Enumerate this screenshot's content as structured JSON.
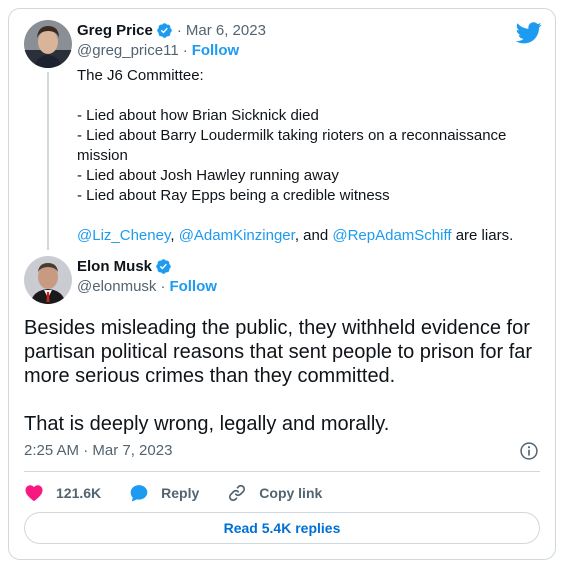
{
  "quoted_tweet": {
    "author_name": "Greg Price",
    "handle": "@greg_price11",
    "separator": "·",
    "date": "Mar 6, 2023",
    "follow_label": "Follow",
    "lines": [
      "The J6 Committee:",
      "",
      "- Lied about how Brian Sicknick died",
      "- Lied about Barry Loudermilk taking rioters on a reconnaissance mission",
      "- Lied about Josh Hawley running away",
      "- Lied about Ray Epps being a credible witness",
      ""
    ],
    "mention_1": "@Liz_Cheney",
    "comma": ",",
    "mention_2": "@AdamKinzinger",
    "and_text": ", and",
    "mention_3": "@RepAdamSchiff",
    "suffix": " are liars."
  },
  "main_tweet": {
    "author_name": "Elon Musk",
    "handle": "@elonmusk",
    "separator": "·",
    "follow_label": "Follow",
    "paragraph_1": "Besides misleading the public, they withheld evidence for partisan political reasons that sent people to prison for far more serious crimes than they committed.",
    "paragraph_2": "That is deeply wrong, legally and morally.",
    "timestamp": "2:25 AM · Mar 7, 2023"
  },
  "actions": {
    "like_count": "121.6K",
    "reply_label": "Reply",
    "copy_label": "Copy link"
  },
  "read_replies_label": "Read 5.4K replies",
  "icons": {
    "brand": "twitter-bird-icon",
    "verified": "verified-badge-icon",
    "info": "info-icon",
    "like": "heart-icon",
    "reply": "speech-bubble-icon",
    "copy": "link-icon"
  },
  "colors": {
    "accent": "#1d9bf0",
    "like": "#f91880",
    "muted": "#536471",
    "border": "#cfd9de",
    "replies_text": "#006fd6"
  }
}
